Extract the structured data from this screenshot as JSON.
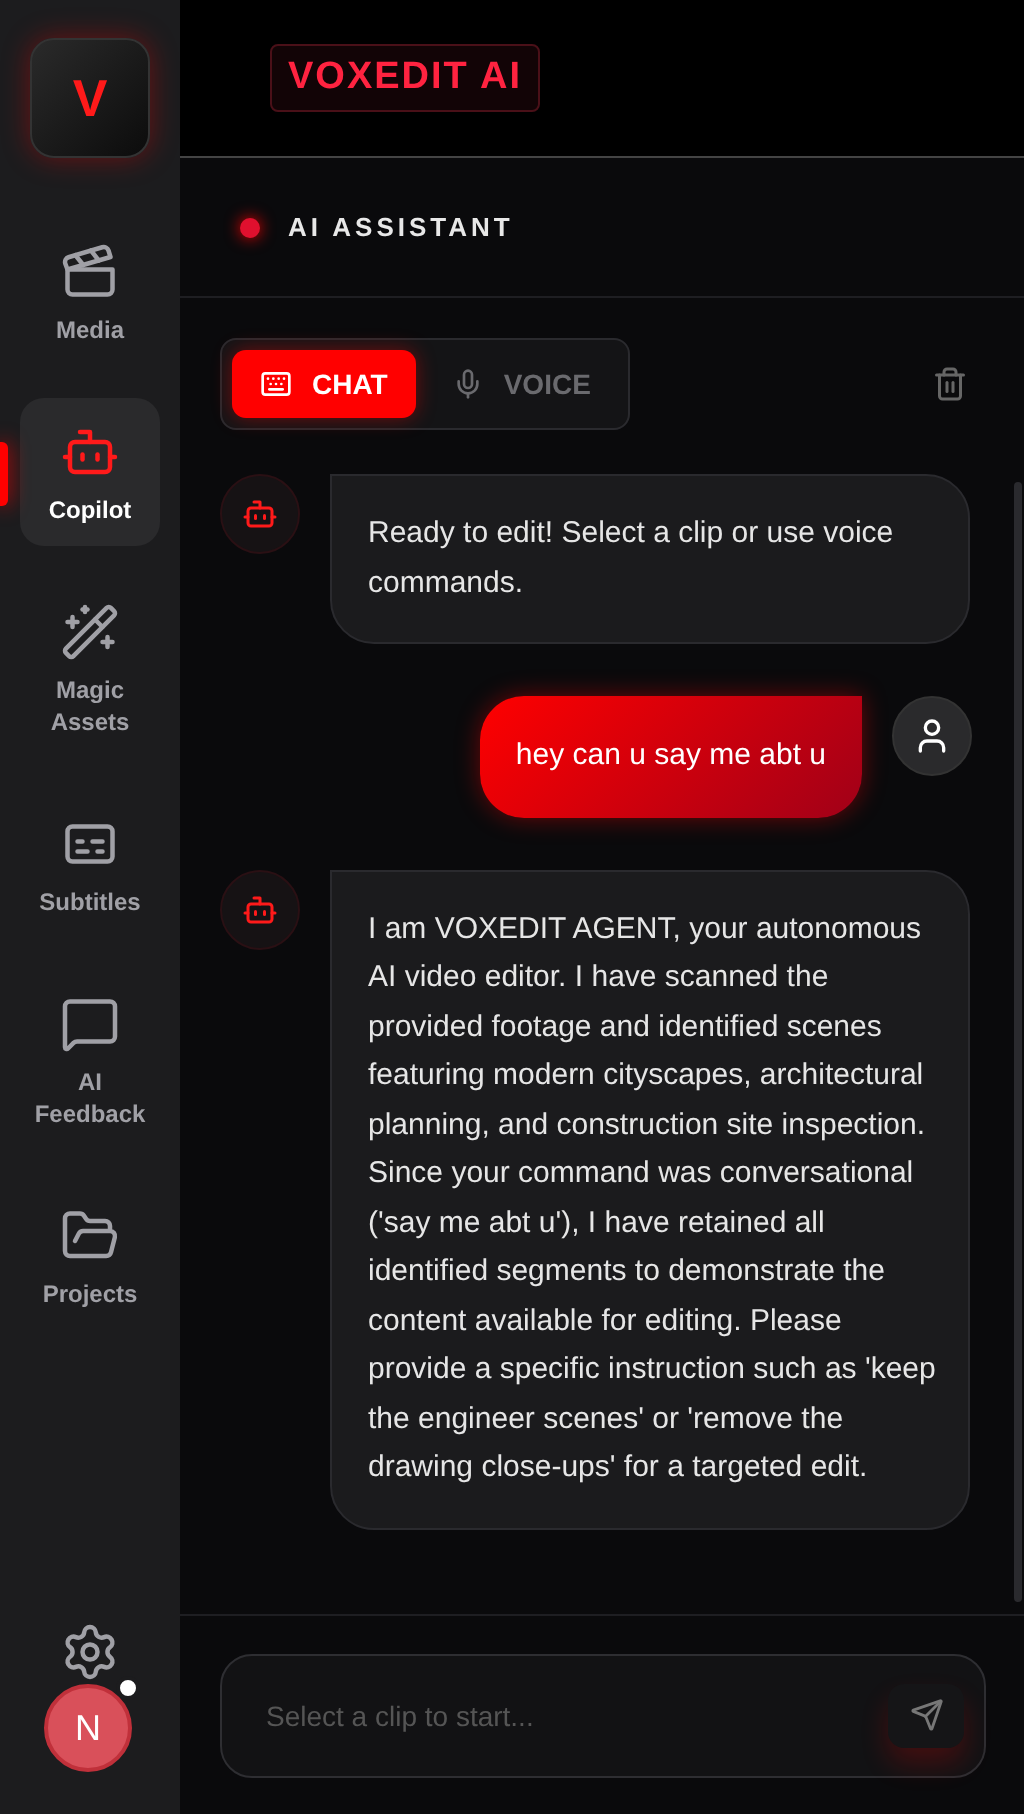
{
  "logo": {
    "letter": "V"
  },
  "sidebar": {
    "items": [
      {
        "label": "Media",
        "selected": false
      },
      {
        "label": "Copilot",
        "selected": true
      },
      {
        "label": "Magic Assets",
        "selected": false
      },
      {
        "label": "Subtitles",
        "selected": false
      },
      {
        "label": "AI Feedback",
        "selected": false
      },
      {
        "label": "Projects",
        "selected": false
      }
    ],
    "avatar": {
      "initial": "N",
      "online": true
    }
  },
  "header": {
    "title": "VOXEDIT AI"
  },
  "assistant": {
    "title": "AI ASSISTANT",
    "active": true
  },
  "tabs": [
    {
      "label": "CHAT",
      "selected": true
    },
    {
      "label": "VOICE",
      "selected": false
    }
  ],
  "messages": [
    {
      "kind": "bot",
      "text": "Ready to edit! Select a clip or use voice commands."
    },
    {
      "kind": "user",
      "text": "hey can u say me abt u"
    },
    {
      "kind": "bot",
      "text": "I am VOXEDIT AGENT, your autonomous AI video editor. I have scanned the provided footage and identified scenes featuring modern cityscapes, architectural planning, and construction site inspection. Since your command was conversational ('say me abt u'), I have retained all identified segments to demonstrate the content available for editing. Please provide a specific instruction such as 'keep the engineer scenes' or 'remove the drawing close-ups' for a targeted edit."
    }
  ],
  "input": {
    "placeholder": "Select a clip to start..."
  }
}
